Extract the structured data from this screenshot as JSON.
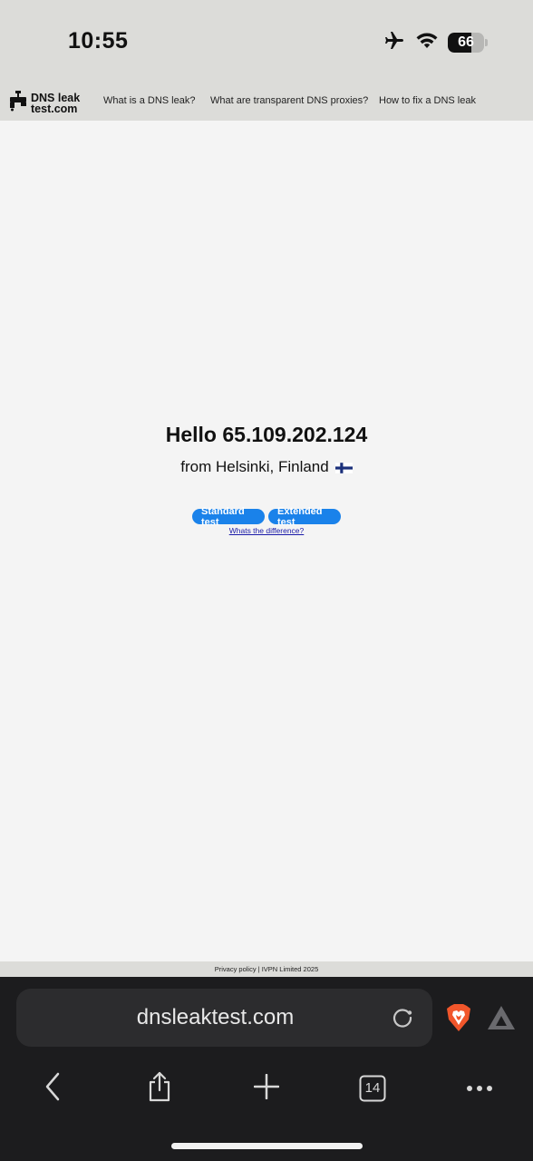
{
  "status_bar": {
    "time": "10:55",
    "battery_level": 66,
    "battery_text": "66",
    "icons": [
      "airplane-icon",
      "wifi-icon",
      "battery-icon"
    ]
  },
  "site": {
    "logo_line1": "DNS leak",
    "logo_line2": "test.com",
    "nav": [
      {
        "label": "What is a DNS leak?"
      },
      {
        "label": "What are transparent DNS proxies?"
      },
      {
        "label": "How to fix a DNS leak"
      }
    ]
  },
  "main": {
    "greeting": "Hello 65.109.202.124",
    "location": "from Helsinki, Finland",
    "flag": "flag-finland-icon",
    "standard_button": "Standard test",
    "extended_button": "Extended test",
    "difference_link": "Whats the difference?"
  },
  "footer": {
    "text": "Privacy policy | IVPN Limited 2025"
  },
  "browser": {
    "url": "dnsleaktest.com",
    "tab_count": "14",
    "accent_colors": {
      "brave": "#f1562b",
      "link_button": "#1a82ea"
    }
  }
}
